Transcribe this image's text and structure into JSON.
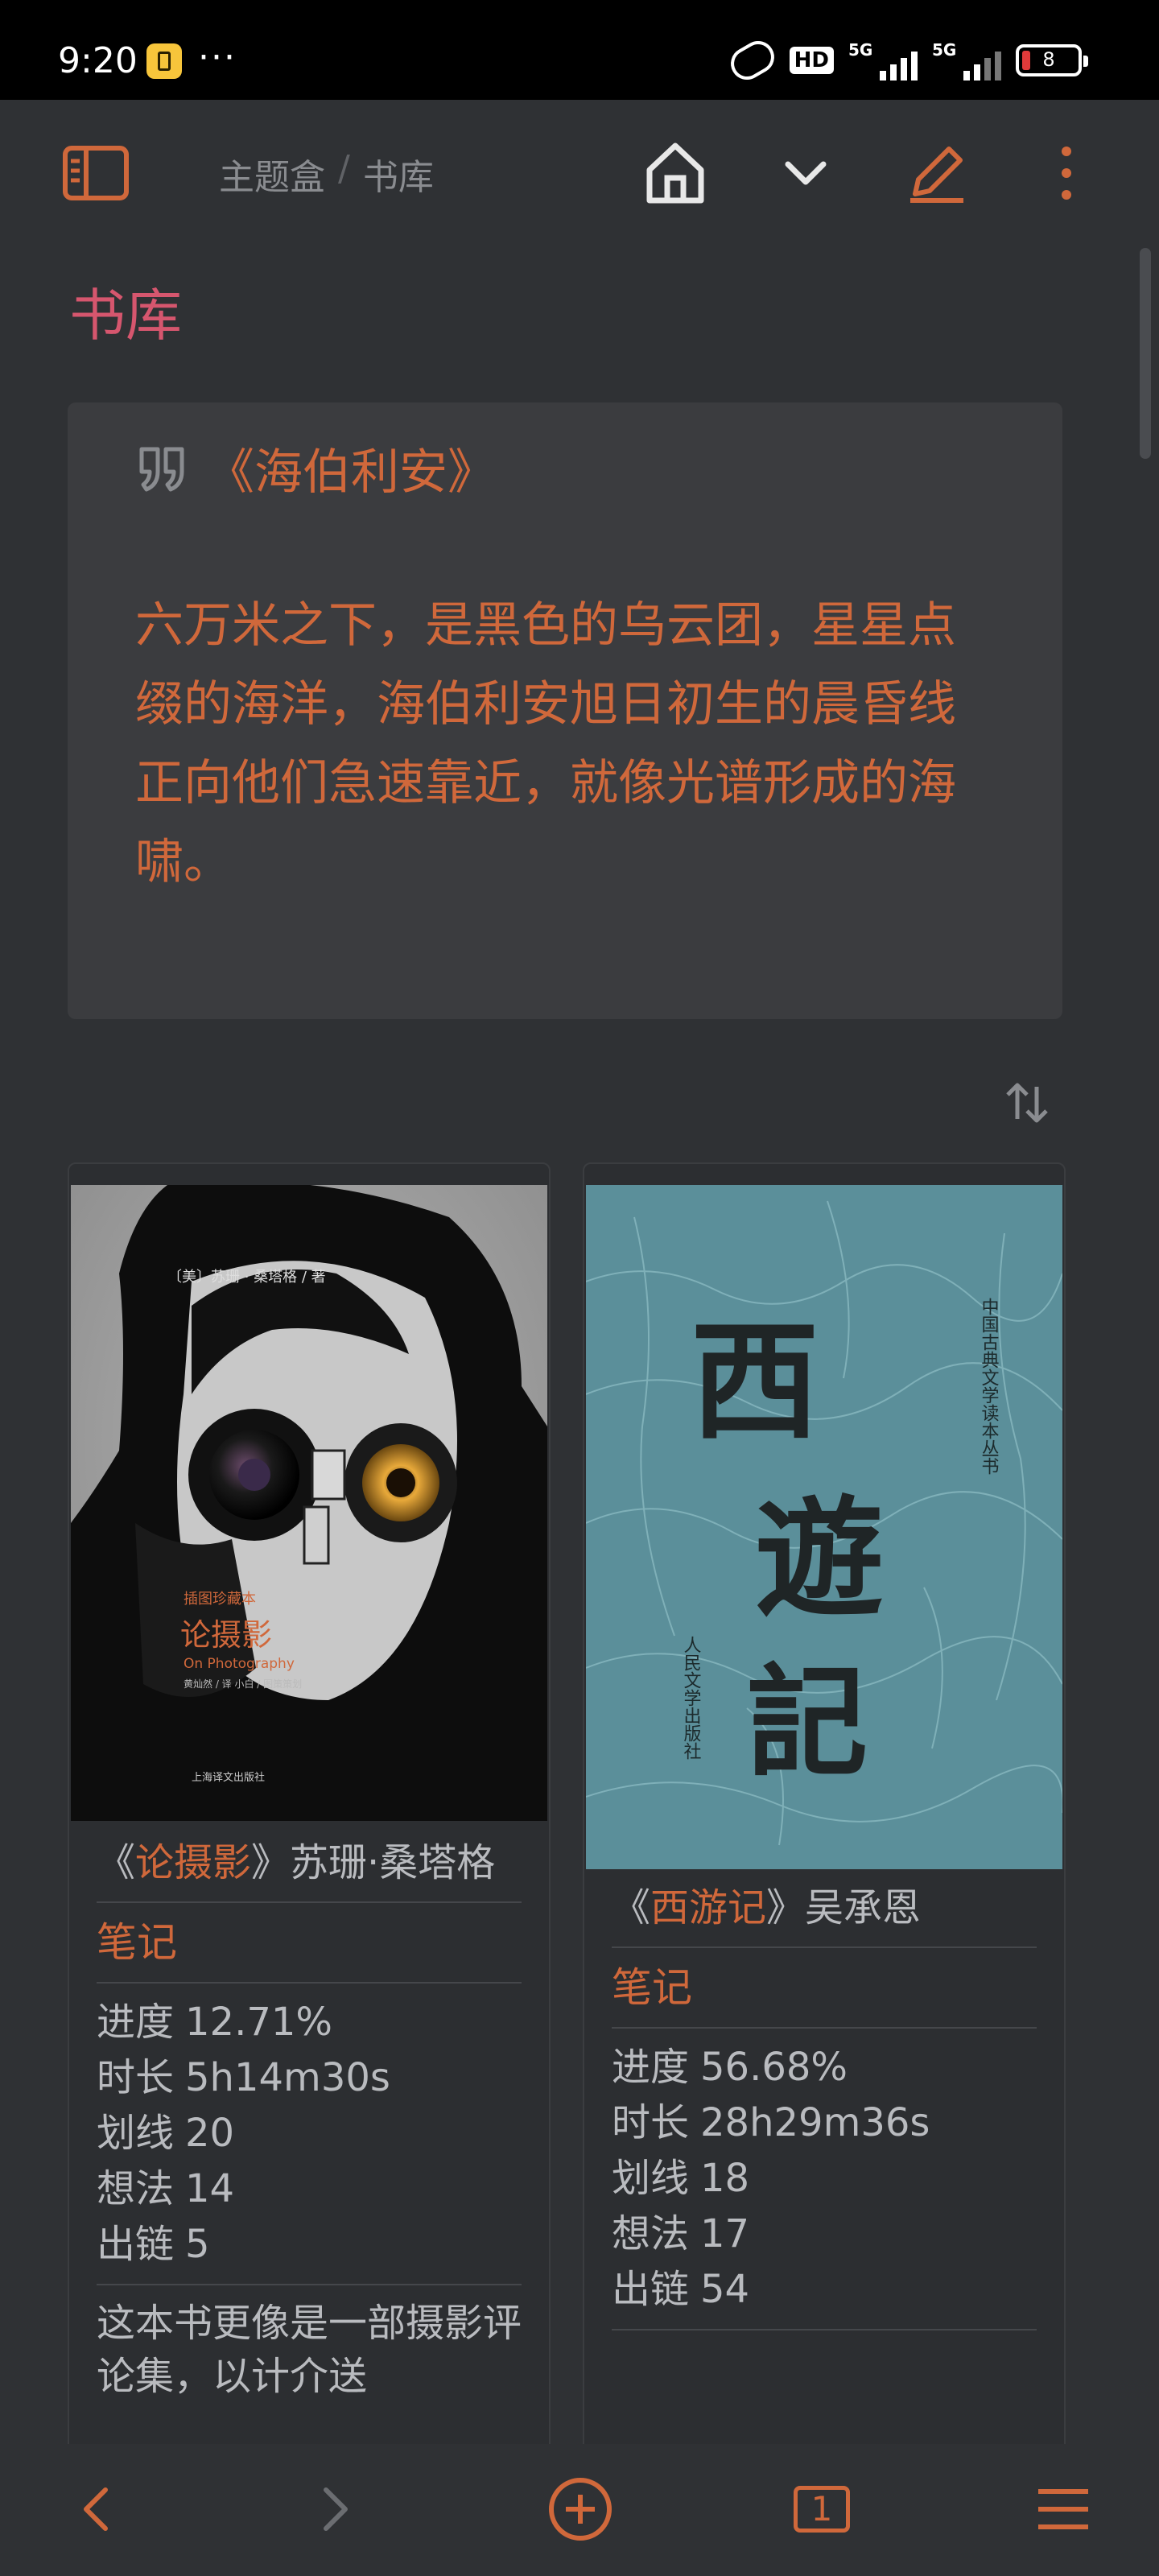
{
  "status_bar": {
    "time": "9:20",
    "dots": "···",
    "hd": "HD",
    "network1": "5G",
    "network2": "5G",
    "battery": "8"
  },
  "topbar": {
    "breadcrumb": [
      "主题盒",
      "书库"
    ],
    "separator": "/"
  },
  "page": {
    "title": "书库"
  },
  "quote": {
    "book": "《海伯利安》",
    "text": "六万米之下，是黑色的乌云团，星星点缀的海洋，海伯利安旭日初生的晨昏线正向他们急速靠近，就像光谱形成的海啸。"
  },
  "books": [
    {
      "title_open": "《",
      "title": "论摄影",
      "title_close": "》",
      "author": "苏珊·桑塔格",
      "note_link": "笔记",
      "stats": [
        {
          "label": "进度",
          "value": "12.71%"
        },
        {
          "label": "时长",
          "value": "5h14m30s"
        },
        {
          "label": "划线",
          "value": "20"
        },
        {
          "label": "想法",
          "value": "14"
        },
        {
          "label": "出链",
          "value": "5"
        }
      ],
      "description": "这本书更像是一部摄影评论集，以计介送",
      "cover": {
        "author_line": "〔美〕苏珊 · 桑塔格 / 著",
        "edition": "插图珍藏本",
        "title": "论摄影",
        "subtitle": "On Photography",
        "translators": "黄灿然 / 译  小白 / 图策策划",
        "publisher": "上海译文出版社"
      }
    },
    {
      "title_open": "《",
      "title": "西游记",
      "title_close": "》",
      "author": "吴承恩",
      "note_link": "笔记",
      "stats": [
        {
          "label": "进度",
          "value": "56.68%"
        },
        {
          "label": "时长",
          "value": "28h29m36s"
        },
        {
          "label": "划线",
          "value": "18"
        },
        {
          "label": "想法",
          "value": "17"
        },
        {
          "label": "出链",
          "value": "54"
        }
      ],
      "cover": {
        "series": "中国古典文学读本丛书",
        "title_chars": [
          "西",
          "遊",
          "記"
        ],
        "publisher": "人民文学出版社"
      }
    }
  ],
  "bottombar": {
    "tab_count": "1"
  },
  "colors": {
    "accent": "#d0683b",
    "title_pink": "#d6566e",
    "background": "#2f3134",
    "card": "#3b3c3f"
  }
}
